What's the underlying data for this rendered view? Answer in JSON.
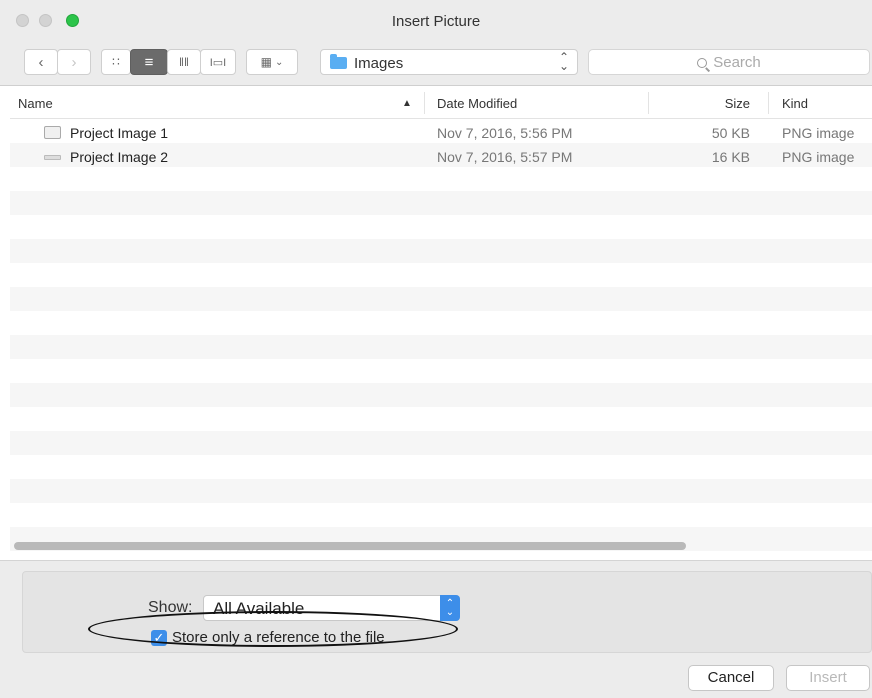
{
  "window": {
    "title": "Insert Picture"
  },
  "toolbar": {
    "back_icon": "chevron-left",
    "forward_icon": "chevron-right",
    "location": "Images",
    "search_placeholder": "Search"
  },
  "columns": {
    "name": "Name",
    "date": "Date Modified",
    "size": "Size",
    "kind": "Kind"
  },
  "files": [
    {
      "name": "Project Image 1",
      "date": "Nov 7, 2016, 5:56 PM",
      "size": "50 KB",
      "kind": "PNG image"
    },
    {
      "name": "Project Image 2",
      "date": "Nov 7, 2016, 5:57 PM",
      "size": "16 KB",
      "kind": "PNG image"
    }
  ],
  "options": {
    "show_label": "Show:",
    "show_value": "All Available",
    "store_reference_label": "Store only a reference to the file",
    "store_reference_checked": true
  },
  "buttons": {
    "cancel": "Cancel",
    "insert": "Insert"
  },
  "colors": {
    "accent": "#3d8ee9",
    "folder": "#5aaef2",
    "zoom_button": "#2cc44a"
  }
}
